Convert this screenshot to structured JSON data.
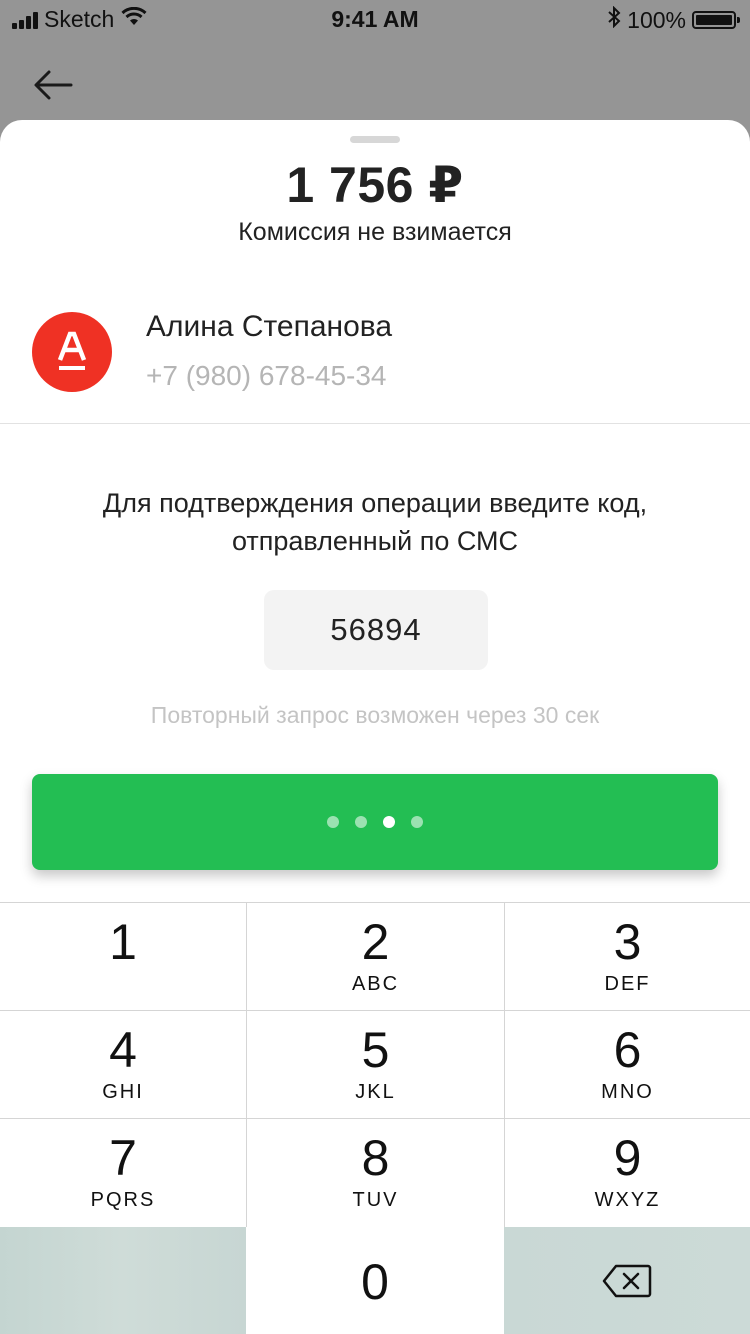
{
  "status_bar": {
    "carrier": "Sketch",
    "time": "9:41 AM",
    "battery_percent": "100%",
    "battery_level": 1.0,
    "icons": [
      "signal-icon",
      "wifi-icon",
      "bluetooth-icon",
      "battery-icon"
    ]
  },
  "navigation": {
    "back_icon": "arrow-left-icon"
  },
  "payment": {
    "amount": "1 756 ₽",
    "commission": "Комиссия не взимается"
  },
  "recipient": {
    "avatar_letter": "А",
    "avatar_color": "#ef3124",
    "name": "Алина Степанова",
    "phone": "+7 (980) 678-45-34"
  },
  "confirmation": {
    "instruction": "Для подтверждения операции введите код, отправленный по СМС",
    "code": "56894",
    "resend_text": "Повторный запрос возможен через 30 сек"
  },
  "confirm_button": {
    "color": "#23be53",
    "state": "loading",
    "loading_dots": 4,
    "active_dot": 3
  },
  "keypad": {
    "keys": [
      {
        "digit": "1",
        "letters": ""
      },
      {
        "digit": "2",
        "letters": "ABC"
      },
      {
        "digit": "3",
        "letters": "DEF"
      },
      {
        "digit": "4",
        "letters": "GHI"
      },
      {
        "digit": "5",
        "letters": "JKL"
      },
      {
        "digit": "6",
        "letters": "MNO"
      },
      {
        "digit": "7",
        "letters": "PQRS"
      },
      {
        "digit": "8",
        "letters": "TUV"
      },
      {
        "digit": "9",
        "letters": "WXYZ"
      },
      {
        "digit": "0",
        "letters": ""
      }
    ],
    "delete_icon": "backspace-icon"
  }
}
